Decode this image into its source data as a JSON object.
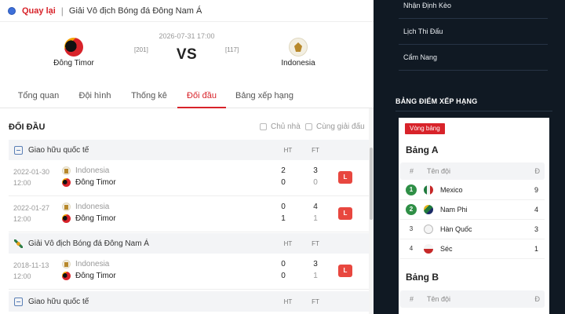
{
  "breadcrumb": {
    "back_label": "Quay lại",
    "separator": "|",
    "league": "Giải Vô địch Bóng đá Đông Nam Á"
  },
  "match": {
    "datetime": "2026-07-31 17:00",
    "vs_label": "VS",
    "home": {
      "name": "Đông Timor",
      "rank": "[201]"
    },
    "away": {
      "name": "Indonesia",
      "rank": "[117]"
    }
  },
  "tabs": [
    "Tổng quan",
    "Đội hình",
    "Thống kê",
    "Đối đầu",
    "Bảng xếp hạng"
  ],
  "active_tab": "Đối đầu",
  "h2h": {
    "title": "ĐỐI ĐẦU",
    "filter_home": "Chủ nhà",
    "filter_same_league": "Cùng giải đấu",
    "sections": [
      {
        "name": "Giao hữu quốc tế",
        "ht": "HT",
        "ft": "FT"
      },
      {
        "name": "Giải Vô địch Bóng đá Đông Nam Á",
        "ht": "HT",
        "ft": "FT"
      },
      {
        "name": "Giao hữu quốc tế",
        "ht": "HT",
        "ft": "FT"
      }
    ],
    "matches": [
      {
        "date": "2022-01-30",
        "time": "12:00",
        "team1": "Indonesia",
        "team2": "Đông Timor",
        "ht1": "2",
        "ht2": "0",
        "ft1": "3",
        "ft2": "0",
        "result": "L"
      },
      {
        "date": "2022-01-27",
        "time": "12:00",
        "team1": "Indonesia",
        "team2": "Đông Timor",
        "ht1": "0",
        "ht2": "1",
        "ft1": "4",
        "ft2": "1",
        "result": "L"
      },
      {
        "date": "2018-11-13",
        "time": "12:00",
        "team1": "Indonesia",
        "team2": "Đông Timor",
        "ht1": "0",
        "ht2": "0",
        "ft1": "3",
        "ft2": "1",
        "result": "L"
      }
    ]
  },
  "sidebar": {
    "menu": [
      "Nhận Định Kèo",
      "Lịch Thi Đấu",
      "Cẩm Nang"
    ],
    "standings_title": "BẢNG ĐIỂM XẾP HẠNG",
    "stage_badge": "Vòng bảng",
    "col_pos": "#",
    "col_team": "Tên đội",
    "col_pts": "Đ",
    "groups": [
      {
        "name": "Bảng A",
        "rows": [
          {
            "pos": "1",
            "team": "Mexico",
            "pts": "9"
          },
          {
            "pos": "2",
            "team": "Nam Phi",
            "pts": "4"
          },
          {
            "pos": "3",
            "team": "Hàn Quốc",
            "pts": "3"
          },
          {
            "pos": "4",
            "team": "Séc",
            "pts": "1"
          }
        ]
      },
      {
        "name": "Bảng B",
        "rows": []
      }
    ]
  },
  "colors": {
    "accent": "#d8232a",
    "loss_badge": "#e8473f",
    "qualify": "#2f8f46",
    "sidebar_bg": "#101923"
  }
}
